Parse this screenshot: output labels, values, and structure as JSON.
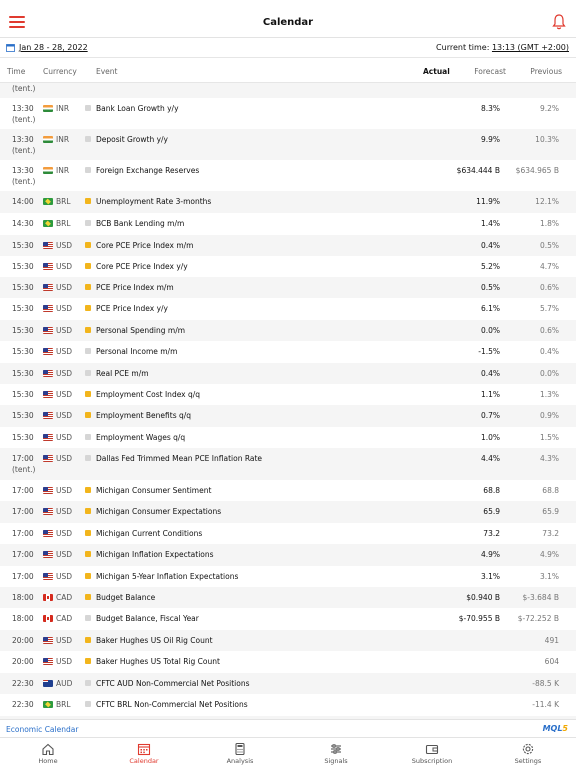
{
  "header": {
    "title": "Calendar"
  },
  "datebar": {
    "date_range": "Jan 28 - 28, 2022",
    "current_time_label": "Current time:",
    "current_time_value": "13:13 (GMT +2:00)"
  },
  "columns": {
    "time": "Time",
    "currency": "Currency",
    "event": "Event",
    "actual": "Actual",
    "forecast": "Forecast",
    "previous": "Previous"
  },
  "tent_label": "(tent.)",
  "rows": [
    {
      "time": "",
      "tent": "(tent.)",
      "flag": "in",
      "currency": "",
      "importance": "",
      "event": "",
      "forecast": "",
      "previous": ""
    },
    {
      "time": "13:30",
      "tent": "(tent.)",
      "flag": "in",
      "currency": "INR",
      "importance": "low",
      "event": "Bank Loan Growth y/y",
      "forecast": "8.3%",
      "previous": "9.2%"
    },
    {
      "time": "13:30",
      "tent": "(tent.)",
      "flag": "in",
      "currency": "INR",
      "importance": "low",
      "event": "Deposit Growth y/y",
      "forecast": "9.9%",
      "previous": "10.3%"
    },
    {
      "time": "13:30",
      "tent": "(tent.)",
      "flag": "in",
      "currency": "INR",
      "importance": "low",
      "event": "Foreign Exchange Reserves",
      "forecast": "$634.444 B",
      "previous": "$634.965 B"
    },
    {
      "time": "14:00",
      "tent": "",
      "flag": "br",
      "currency": "BRL",
      "importance": "medium",
      "event": "Unemployment Rate 3-months",
      "forecast": "11.9%",
      "previous": "12.1%"
    },
    {
      "time": "14:30",
      "tent": "",
      "flag": "br",
      "currency": "BRL",
      "importance": "low",
      "event": "BCB Bank Lending m/m",
      "forecast": "1.4%",
      "previous": "1.8%"
    },
    {
      "time": "15:30",
      "tent": "",
      "flag": "us",
      "currency": "USD",
      "importance": "medium",
      "event": "Core PCE Price Index m/m",
      "forecast": "0.4%",
      "previous": "0.5%"
    },
    {
      "time": "15:30",
      "tent": "",
      "flag": "us",
      "currency": "USD",
      "importance": "medium",
      "event": "Core PCE Price Index y/y",
      "forecast": "5.2%",
      "previous": "4.7%"
    },
    {
      "time": "15:30",
      "tent": "",
      "flag": "us",
      "currency": "USD",
      "importance": "medium",
      "event": "PCE Price Index m/m",
      "forecast": "0.5%",
      "previous": "0.6%"
    },
    {
      "time": "15:30",
      "tent": "",
      "flag": "us",
      "currency": "USD",
      "importance": "medium",
      "event": "PCE Price Index y/y",
      "forecast": "6.1%",
      "previous": "5.7%"
    },
    {
      "time": "15:30",
      "tent": "",
      "flag": "us",
      "currency": "USD",
      "importance": "medium",
      "event": "Personal Spending m/m",
      "forecast": "0.0%",
      "previous": "0.6%"
    },
    {
      "time": "15:30",
      "tent": "",
      "flag": "us",
      "currency": "USD",
      "importance": "low",
      "event": "Personal Income m/m",
      "forecast": "-1.5%",
      "previous": "0.4%"
    },
    {
      "time": "15:30",
      "tent": "",
      "flag": "us",
      "currency": "USD",
      "importance": "low",
      "event": "Real PCE m/m",
      "forecast": "0.4%",
      "previous": "0.0%"
    },
    {
      "time": "15:30",
      "tent": "",
      "flag": "us",
      "currency": "USD",
      "importance": "medium",
      "event": "Employment Cost Index q/q",
      "forecast": "1.1%",
      "previous": "1.3%"
    },
    {
      "time": "15:30",
      "tent": "",
      "flag": "us",
      "currency": "USD",
      "importance": "medium",
      "event": "Employment Benefits q/q",
      "forecast": "0.7%",
      "previous": "0.9%"
    },
    {
      "time": "15:30",
      "tent": "",
      "flag": "us",
      "currency": "USD",
      "importance": "low",
      "event": "Employment Wages q/q",
      "forecast": "1.0%",
      "previous": "1.5%"
    },
    {
      "time": "17:00",
      "tent": "(tent.)",
      "flag": "us",
      "currency": "USD",
      "importance": "low",
      "event": "Dallas Fed Trimmed Mean PCE Inflation Rate",
      "forecast": "4.4%",
      "previous": "4.3%"
    },
    {
      "time": "17:00",
      "tent": "",
      "flag": "us",
      "currency": "USD",
      "importance": "medium",
      "event": "Michigan Consumer Sentiment",
      "forecast": "68.8",
      "previous": "68.8"
    },
    {
      "time": "17:00",
      "tent": "",
      "flag": "us",
      "currency": "USD",
      "importance": "medium",
      "event": "Michigan Consumer Expectations",
      "forecast": "65.9",
      "previous": "65.9"
    },
    {
      "time": "17:00",
      "tent": "",
      "flag": "us",
      "currency": "USD",
      "importance": "medium",
      "event": "Michigan Current Conditions",
      "forecast": "73.2",
      "previous": "73.2"
    },
    {
      "time": "17:00",
      "tent": "",
      "flag": "us",
      "currency": "USD",
      "importance": "medium",
      "event": "Michigan Inflation Expectations",
      "forecast": "4.9%",
      "previous": "4.9%"
    },
    {
      "time": "17:00",
      "tent": "",
      "flag": "us",
      "currency": "USD",
      "importance": "medium",
      "event": "Michigan 5-Year Inflation Expectations",
      "forecast": "3.1%",
      "previous": "3.1%"
    },
    {
      "time": "18:00",
      "tent": "",
      "flag": "ca",
      "currency": "CAD",
      "importance": "medium",
      "event": "Budget Balance",
      "forecast": "$0.940 B",
      "previous": "$-3.684 B"
    },
    {
      "time": "18:00",
      "tent": "",
      "flag": "ca",
      "currency": "CAD",
      "importance": "low",
      "event": "Budget Balance, Fiscal Year",
      "forecast": "$-70.955 B",
      "previous": "$-72.252 B"
    },
    {
      "time": "20:00",
      "tent": "",
      "flag": "us",
      "currency": "USD",
      "importance": "medium",
      "event": "Baker Hughes US Oil Rig Count",
      "forecast": "",
      "previous": "491"
    },
    {
      "time": "20:00",
      "tent": "",
      "flag": "us",
      "currency": "USD",
      "importance": "medium",
      "event": "Baker Hughes US Total Rig Count",
      "forecast": "",
      "previous": "604"
    },
    {
      "time": "22:30",
      "tent": "",
      "flag": "au",
      "currency": "AUD",
      "importance": "low",
      "event": "CFTC AUD Non-Commercial Net Positions",
      "forecast": "",
      "previous": "-88.5 K"
    },
    {
      "time": "22:30",
      "tent": "",
      "flag": "br",
      "currency": "BRL",
      "importance": "low",
      "event": "CFTC BRL Non-Commercial Net Positions",
      "forecast": "",
      "previous": "-11.4 K"
    },
    {
      "time": "",
      "tent": "",
      "flag": "",
      "currency": "",
      "importance": "",
      "event": "",
      "forecast": "",
      "previous": ""
    }
  ],
  "footer": {
    "link": "Economic Calendar",
    "logo_main": "MQL",
    "logo_accent": "5"
  },
  "tabs": [
    {
      "label": "Home",
      "icon": "home-icon"
    },
    {
      "label": "Calendar",
      "icon": "calendar-icon",
      "active": true
    },
    {
      "label": "Analysis",
      "icon": "calculator-icon"
    },
    {
      "label": "Signals",
      "icon": "sliders-icon"
    },
    {
      "label": "Subscription",
      "icon": "wallet-icon"
    },
    {
      "label": "Settings",
      "icon": "gear-icon"
    }
  ],
  "colors": {
    "accent": "#e03a2f",
    "link": "#2a6fc9",
    "importance_medium": "#f2b51c",
    "importance_low": "#d6d6d6"
  }
}
